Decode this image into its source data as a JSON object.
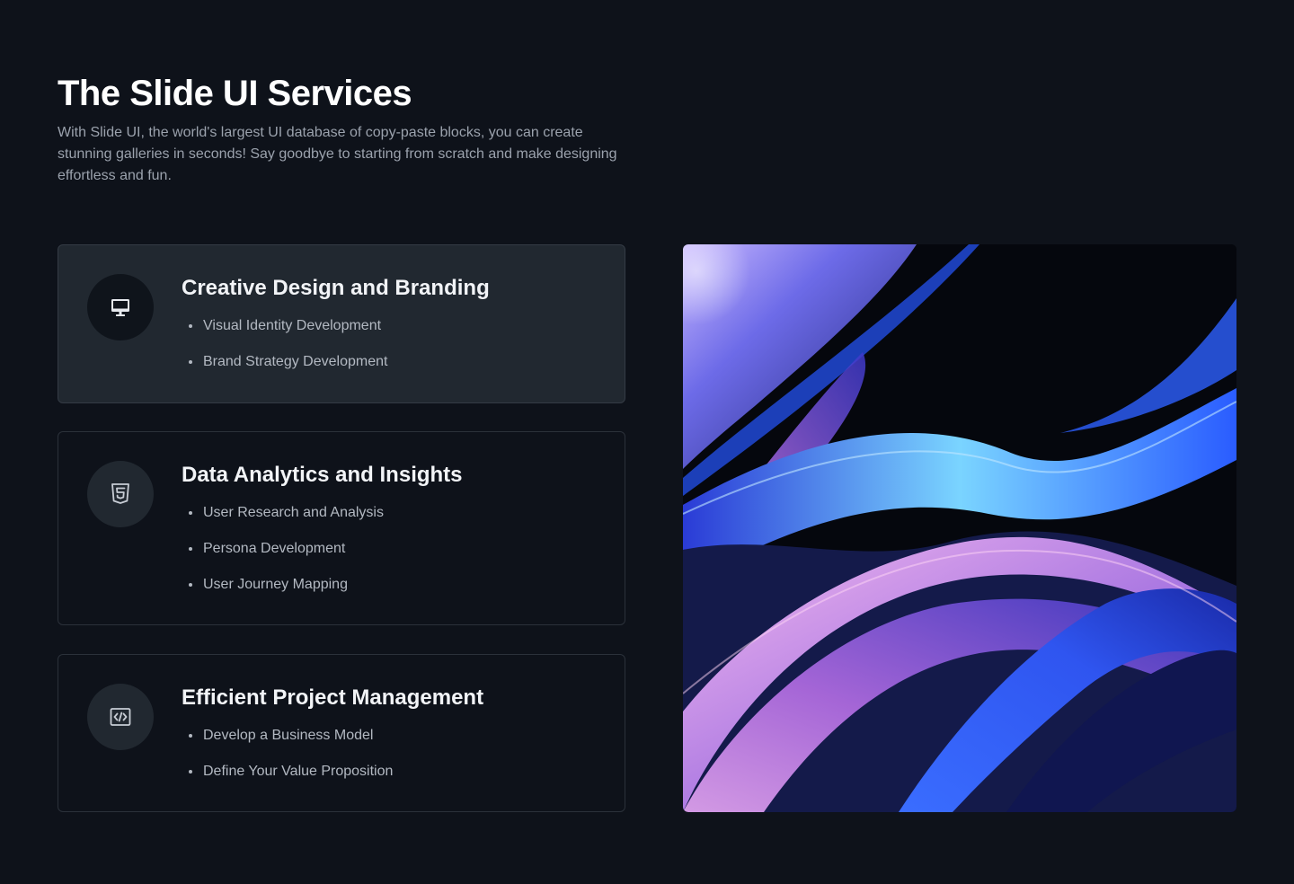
{
  "header": {
    "title": "The Slide UI Services",
    "description": "With Slide UI, the world's largest UI database of copy-paste blocks, you can create stunning galleries in seconds! Say goodbye to starting from scratch and make designing effortless and fun."
  },
  "services": [
    {
      "title": "Creative Design and Branding",
      "icon": "monitor-icon",
      "active": true,
      "items": [
        "Visual Identity Development",
        "Brand Strategy Development"
      ]
    },
    {
      "title": "Data Analytics and Insights",
      "icon": "html5-icon",
      "active": false,
      "items": [
        "User Research and Analysis",
        "Persona Development",
        "User Journey Mapping"
      ]
    },
    {
      "title": "Efficient Project Management",
      "icon": "code-icon",
      "active": false,
      "items": [
        "Develop a Business Model",
        "Define Your Value Proposition"
      ]
    }
  ],
  "colors": {
    "background": "#0e121a",
    "active_card": "#212830",
    "border": "#2b313a",
    "text_muted": "#9ba2ad"
  },
  "image": {
    "name": "abstract-waves-image"
  }
}
